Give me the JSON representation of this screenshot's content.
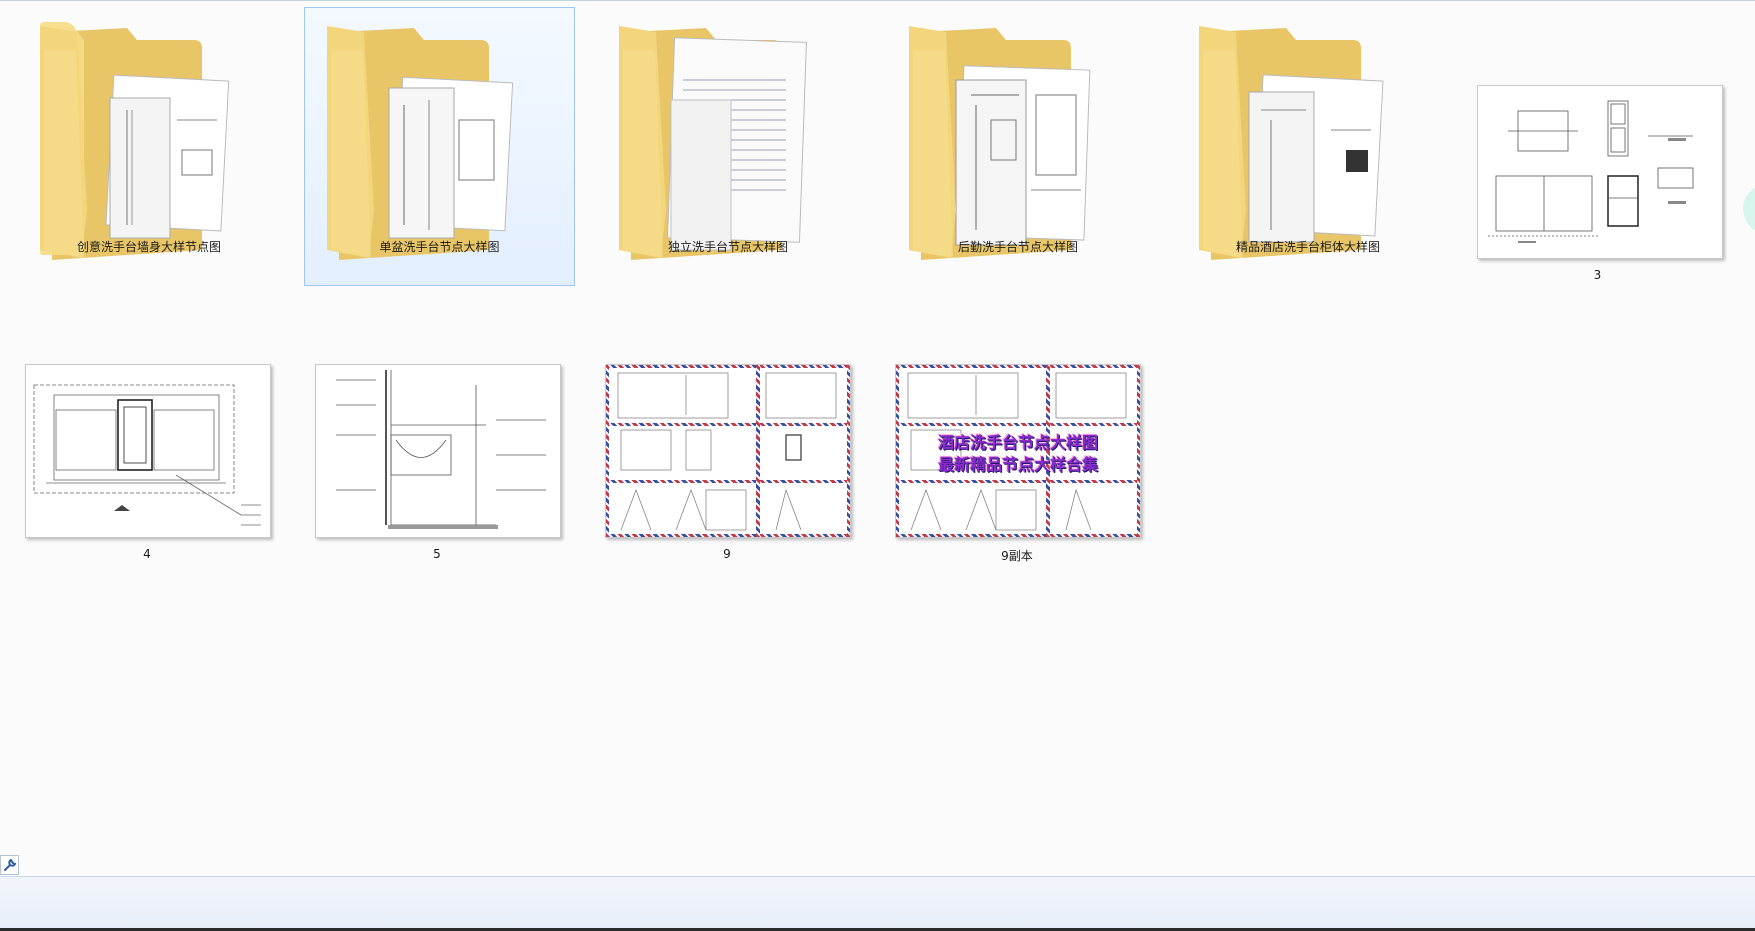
{
  "items": [
    {
      "name": "创意洗手台墙身大样节点图",
      "type": "folder"
    },
    {
      "name": "单盆洗手台节点大样图",
      "type": "folder",
      "selected": true
    },
    {
      "name": "独立洗手台节点大样图",
      "type": "folder"
    },
    {
      "name": "后勤洗手台节点大样图",
      "type": "folder"
    },
    {
      "name": "精品酒店洗手台柜体大样图",
      "type": "folder"
    },
    {
      "name": "3",
      "type": "image"
    },
    {
      "name": "4",
      "type": "image"
    },
    {
      "name": "5",
      "type": "image"
    },
    {
      "name": "9",
      "type": "image"
    },
    {
      "name": "9副本",
      "type": "image",
      "overlay": [
        "酒店洗手台节点大样图",
        "最新精品节点大样合集"
      ]
    }
  ],
  "icons": {
    "tool": "wrench-icon",
    "folder": "folder-icon"
  },
  "colors": {
    "folder": "#f3d57c",
    "selection": "#cde4fb",
    "stripe_red": "#c0394d",
    "stripe_blue": "#3a4fa0",
    "overlay_text": "#8a2bd0"
  }
}
